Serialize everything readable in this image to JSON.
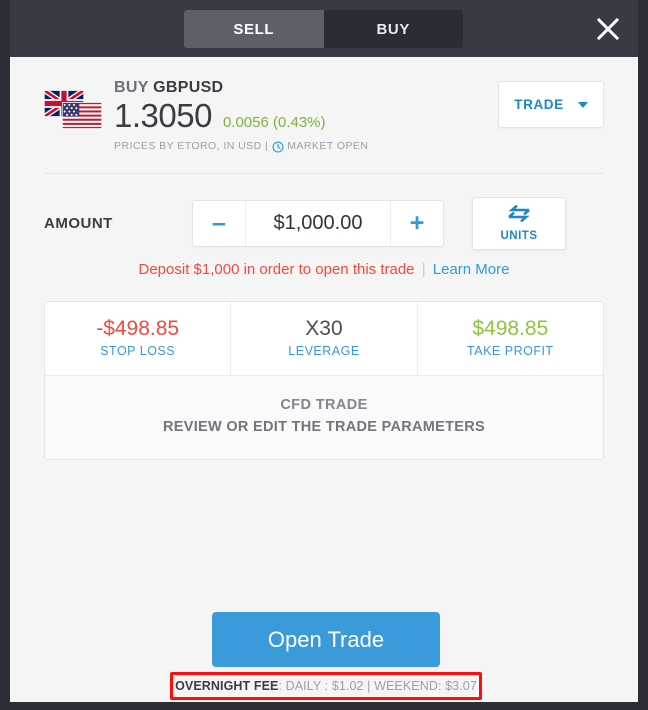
{
  "header": {
    "tabs": [
      {
        "label": "SELL",
        "active": true
      },
      {
        "label": "BUY",
        "active": false
      }
    ],
    "close_icon": "close-icon"
  },
  "instrument": {
    "direction": "BUY",
    "symbol": "GBPUSD",
    "price": "1.3050",
    "change": "0.0056 (0.43%)",
    "change_color": "#7cb342",
    "meta_prefix": "PRICES BY ETORO, IN USD |",
    "market_status": "MARKET OPEN",
    "clock_icon": "clock-icon",
    "flags": [
      "uk-flag-icon",
      "us-flag-icon"
    ]
  },
  "trade_dropdown": {
    "label": "TRADE",
    "caret_icon": "chevron-down-icon"
  },
  "amount": {
    "label": "AMOUNT",
    "value": "$1,000.00",
    "decrement_label": "–",
    "increment_label": "+",
    "units_label": "UNITS",
    "units_icon": "swap-arrows-icon"
  },
  "deposit_note": {
    "warning": "Deposit $1,000 in order to open this trade",
    "separator": "|",
    "link": "Learn More",
    "warning_color": "#ef4b3f",
    "link_color": "#2e9bd6"
  },
  "params": [
    {
      "value": "-$498.85",
      "label": "STOP LOSS",
      "color": "#ef4b3f"
    },
    {
      "value": "X30",
      "label": "LEVERAGE",
      "color": "#4a4d52"
    },
    {
      "value": "$498.85",
      "label": "TAKE PROFIT",
      "color": "#8cc63e"
    }
  ],
  "cfd": {
    "title": "CFD TRADE",
    "subtitle": "REVIEW OR EDIT THE TRADE PARAMETERS"
  },
  "footer": {
    "open_trade_label": "Open Trade",
    "open_trade_color": "#3b9ad9",
    "fee_strong": "OVERNIGHT FEE",
    "fee_rest": ": DAILY : $1.02 | WEEKEND: $3.07",
    "highlight_color": "#fb0e0e"
  }
}
